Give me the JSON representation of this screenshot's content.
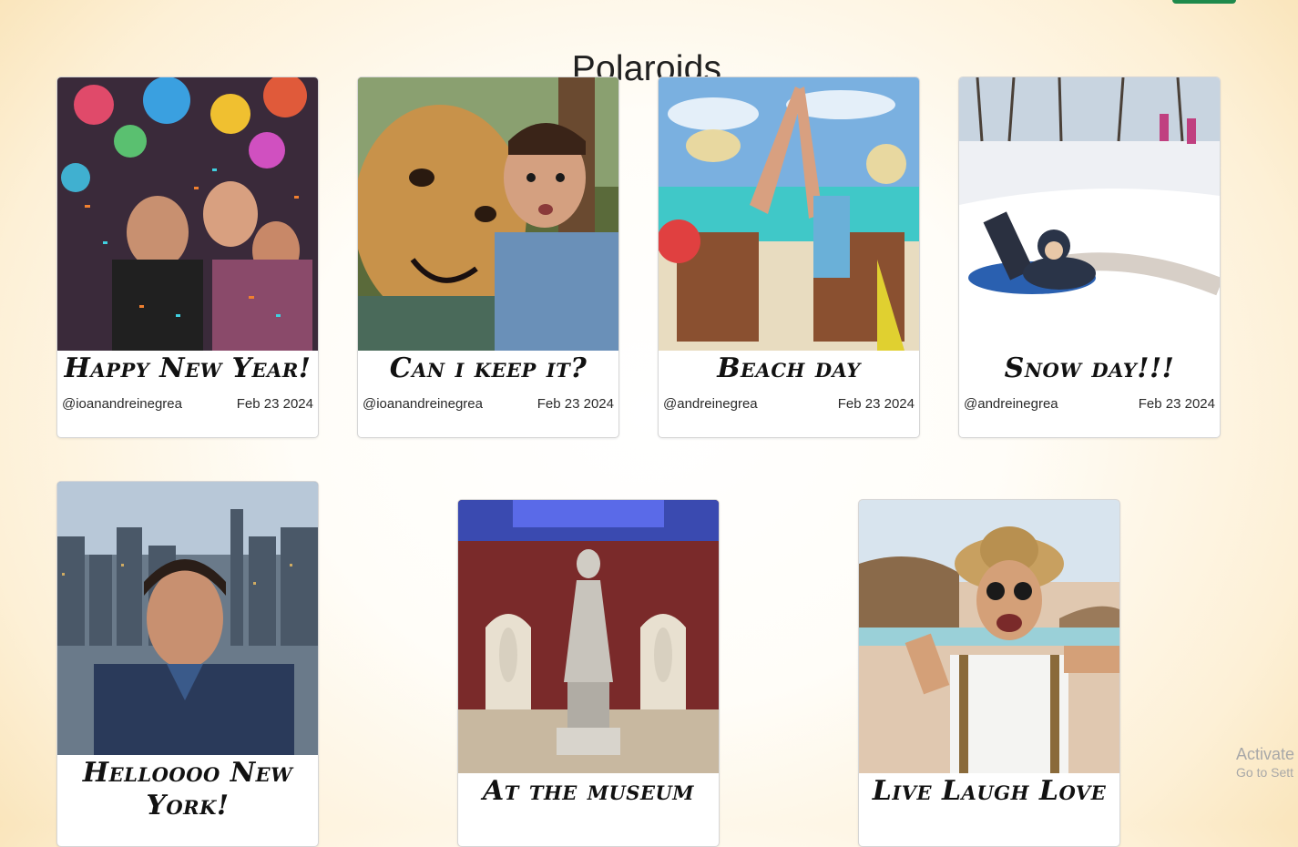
{
  "page": {
    "title": "Polaroids"
  },
  "header": {
    "action_button_label": ""
  },
  "cards": [
    {
      "caption": "Happy New Year!",
      "user": "@ioanandreinegrea",
      "date": "Feb 23 2024"
    },
    {
      "caption": "Can i keep it?",
      "user": "@ioanandreinegrea",
      "date": "Feb 23 2024"
    },
    {
      "caption": "Beach day",
      "user": "@andreinegrea",
      "date": "Feb 23 2024"
    },
    {
      "caption": "Snow day!!!",
      "user": "@andreinegrea",
      "date": "Feb 23 2024"
    },
    {
      "caption": "Helloooo New York!"
    },
    {
      "caption": "At the museum"
    },
    {
      "caption": "Live Laugh Love"
    }
  ],
  "watermark": {
    "line1": "Activate",
    "line2": "Go to Sett"
  },
  "colors": {
    "accent_button": "#1f8a4c",
    "bg_edge": "#f7dca6"
  }
}
